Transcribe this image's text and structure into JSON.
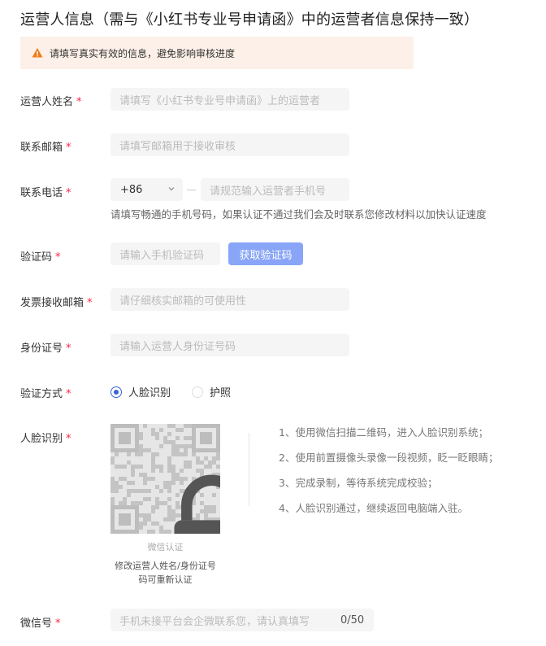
{
  "section_title": "运营人信息（需与《小红书专业号申请函》中的运营者信息保持一致）",
  "notice": "请填写真实有效的信息，避免影响审核进度",
  "required_mark": "*",
  "fields": {
    "operator_name": {
      "label": "运营人姓名",
      "placeholder": "请填写《小红书专业号申请函》上的运营者"
    },
    "contact_email": {
      "label": "联系邮箱",
      "placeholder": "请填写邮箱用于接收审核"
    },
    "contact_phone": {
      "label": "联系电话",
      "country_code": "+86",
      "placeholder": "请规范输入运营者手机号",
      "hint": "请填写畅通的手机号码，如果认证不通过我们会及时联系您修改材料以加快认证速度"
    },
    "verify_code": {
      "label": "验证码",
      "placeholder": "请输入手机验证码",
      "button": "获取验证码"
    },
    "invoice_email": {
      "label": "发票接收邮箱",
      "placeholder": "请仔细核实邮箱的可使用性"
    },
    "id_number": {
      "label": "身份证号",
      "placeholder": "请输入运营人身份证号码"
    },
    "verify_method": {
      "label": "验证方式",
      "options": [
        "人脸识别",
        "护照"
      ],
      "selected": "人脸识别"
    },
    "face_recognition": {
      "label": "人脸识别",
      "qr_caption": "微信认证",
      "qr_note": "修改运营人姓名/身份证号码可重新认证",
      "steps": [
        "1、使用微信扫描二维码，进入人脸识别系统；",
        "2、使用前置摄像头录像一段视频，眨一眨眼睛；",
        "3、完成录制，等待系统完成校验；",
        "4、人脸识别通过，继续返回电脑端入驻。"
      ]
    },
    "wechat_id": {
      "label": "微信号",
      "placeholder": "手机未接平台会企微联系您，请认真填写",
      "counter": "0/50"
    }
  },
  "colors": {
    "required": "#ff2442",
    "accent": "#3a63d8",
    "button": "#89a5f7",
    "notice_bg": "#fdf0e8",
    "warning": "#f07c1a"
  }
}
